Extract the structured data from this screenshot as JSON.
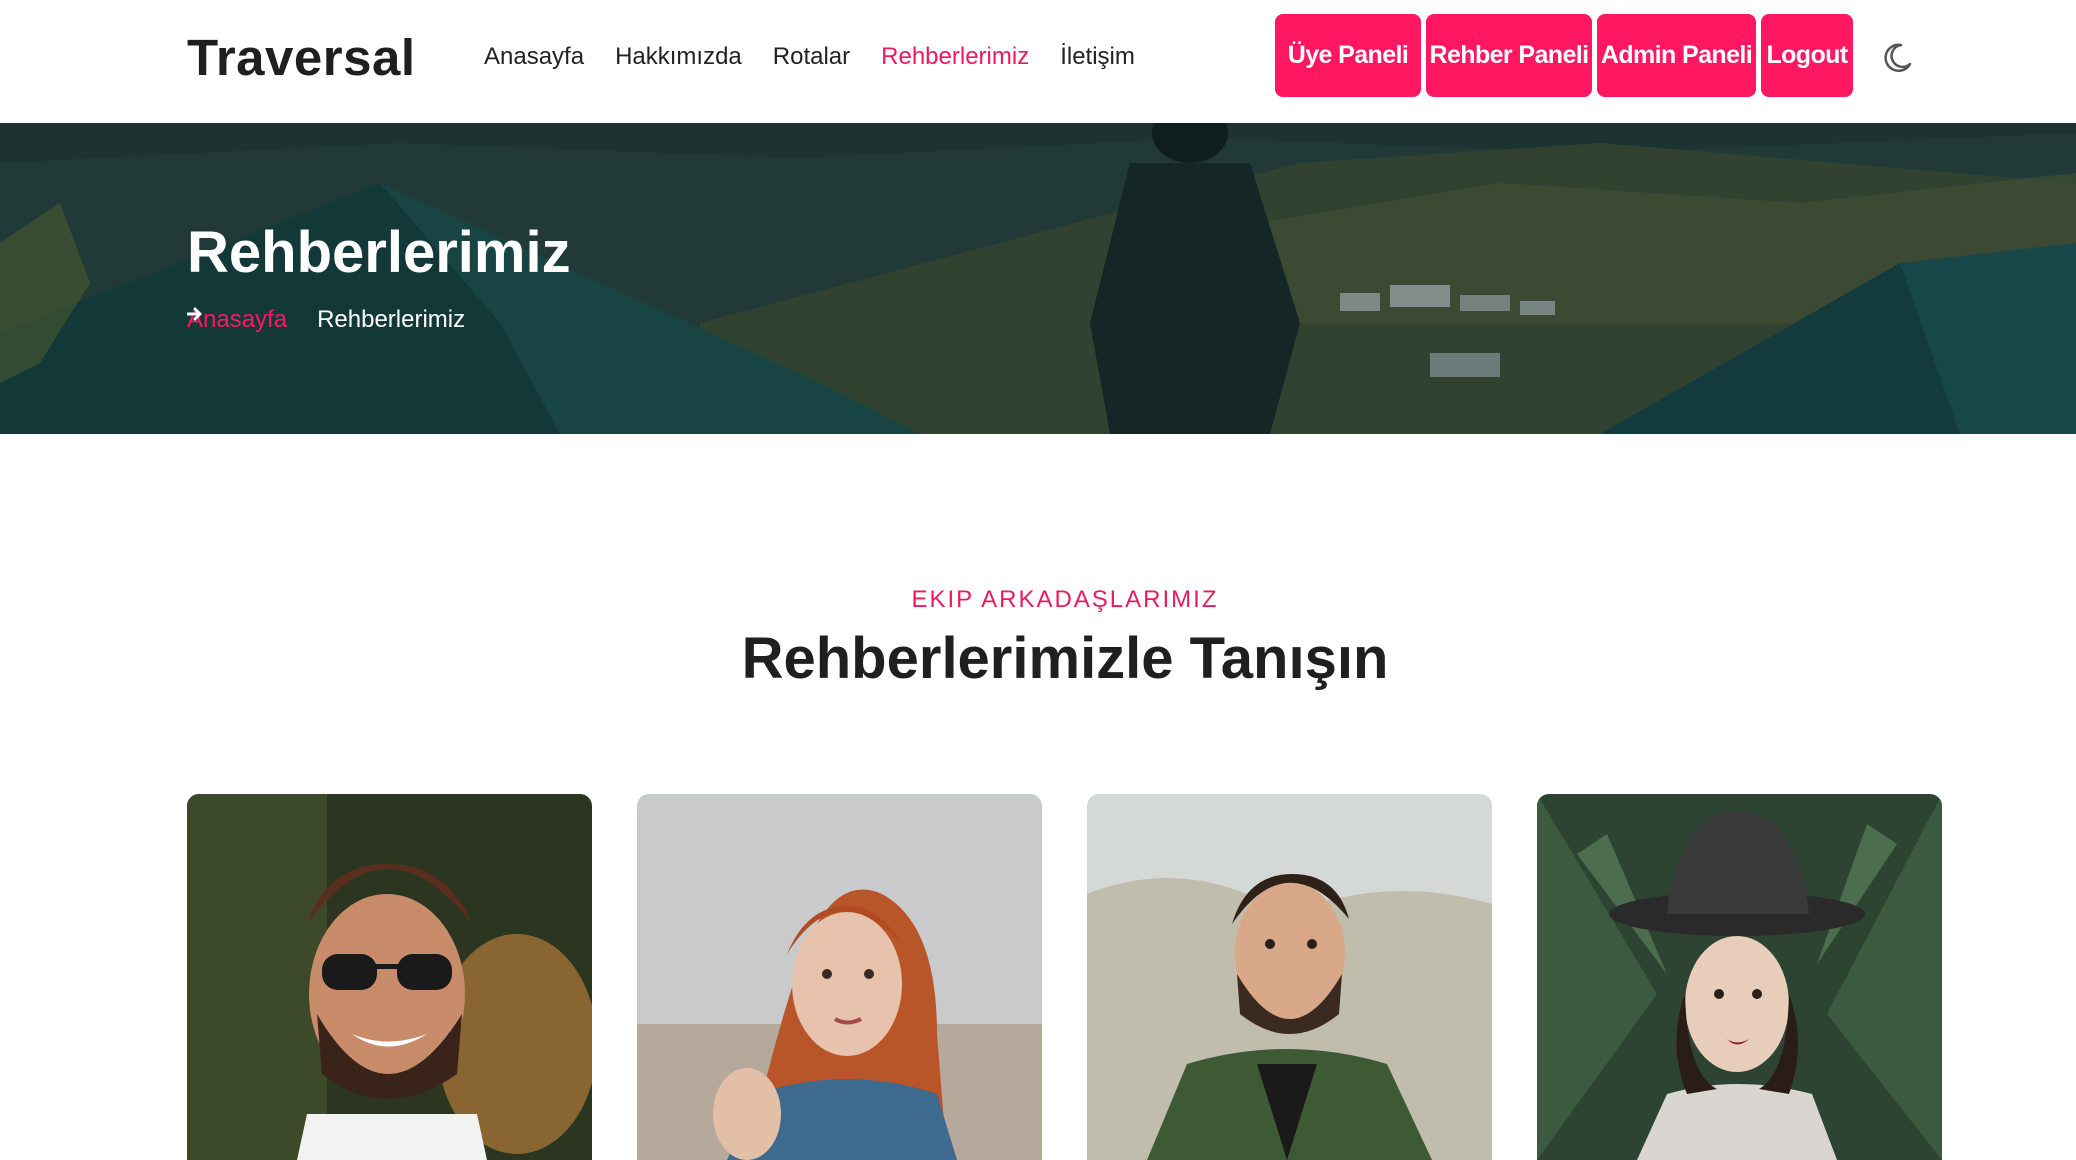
{
  "brand": {
    "logo": "Traversal",
    "accent": "#ff1762"
  },
  "nav": {
    "items": [
      {
        "label": "Anasayfa"
      },
      {
        "label": "Hakkımızda"
      },
      {
        "label": "Rotalar"
      },
      {
        "label": "Rehberlerimiz"
      },
      {
        "label": "İletişim"
      }
    ],
    "active": "Rehberlerimiz"
  },
  "panels": {
    "member": "Üye Paneli",
    "guide": "Rehber Paneli",
    "admin": "Admin Paneli",
    "logout": "Logout"
  },
  "theme_toggle": {
    "icon": "moon-icon"
  },
  "hero": {
    "title": "Rehberlerimiz",
    "breadcrumb": {
      "home": "Anasayfa",
      "separator_icon": "arrow-right-icon",
      "current": "Rehberlerimiz"
    }
  },
  "section": {
    "kicker": "EKIP ARKADAŞLARIMIZ",
    "title": "Rehberlerimizle Tanışın"
  },
  "guides": [
    {
      "photo": "bearded-man-sunglasses-photo"
    },
    {
      "photo": "red-haired-woman-photo"
    },
    {
      "photo": "man-green-jacket-photo"
    },
    {
      "photo": "woman-black-hat-photo"
    }
  ]
}
